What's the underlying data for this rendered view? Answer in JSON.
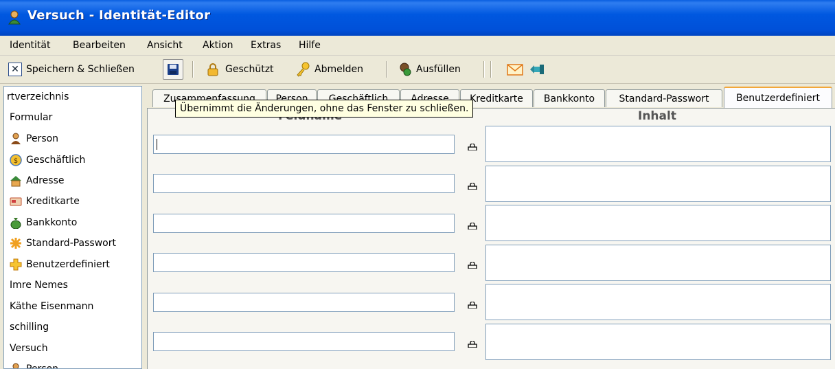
{
  "window": {
    "title": "Versuch - Identität-Editor"
  },
  "menu": [
    "Identität",
    "Bearbeiten",
    "Ansicht",
    "Aktion",
    "Extras",
    "Hilfe"
  ],
  "toolbar": {
    "save_close": "Speichern & Schließen",
    "protected": "Geschützt",
    "logout": "Abmelden",
    "fill": "Ausfüllen"
  },
  "sidebar": {
    "items": [
      {
        "label": "rtverzeichnis",
        "icon": ""
      },
      {
        "label": "Formular",
        "icon": ""
      },
      {
        "label": "Person",
        "icon": "person-icon"
      },
      {
        "label": "Geschäftlich",
        "icon": "coin-icon"
      },
      {
        "label": "Adresse",
        "icon": "house-icon"
      },
      {
        "label": "Kreditkarte",
        "icon": "credit-card-icon"
      },
      {
        "label": "Bankkonto",
        "icon": "money-bag-icon"
      },
      {
        "label": "Standard-Passwort",
        "icon": "asterisk-icon"
      },
      {
        "label": "Benutzerdefiniert",
        "icon": "plus-icon"
      },
      {
        "label": "Imre Nemes",
        "icon": ""
      },
      {
        "label": "Käthe Eisenmann",
        "icon": ""
      },
      {
        "label": "schilling",
        "icon": ""
      },
      {
        "label": "Versuch",
        "icon": ""
      },
      {
        "label": "Person",
        "icon": "person-icon"
      }
    ]
  },
  "tabs": [
    "Zusammenfassung",
    "Person",
    "Geschäftlich",
    "Adresse",
    "Kreditkarte",
    "Bankkonto",
    "Standard-Passwort",
    "Benutzerdefiniert"
  ],
  "active_tab": "Benutzerdefiniert",
  "columns": {
    "name": "Feldname",
    "content": "Inhalt"
  },
  "tooltip": "Übernimmt die Änderungen, ohne das Fenster zu schließen.",
  "colors": {
    "titlebar": "#0058e0",
    "tab_accent": "#f2a73a",
    "tooltip_bg": "#ffffe1"
  }
}
